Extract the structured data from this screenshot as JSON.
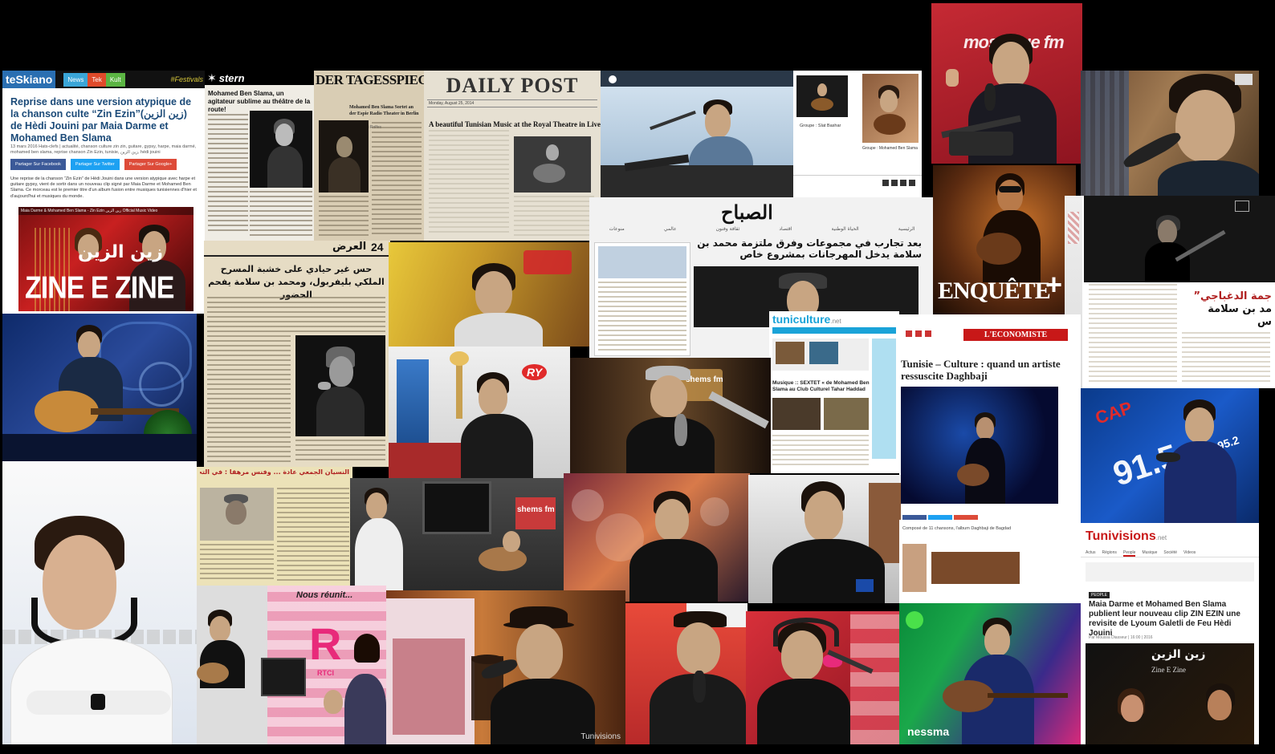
{
  "teskiano": {
    "logo": "teSkiano",
    "nav": [
      "News",
      "Tek",
      "Kult"
    ],
    "festival": "#Festivals",
    "headline": "Reprise dans une version atypique de la chanson culte “Zin Ezin”(زين الزين) de Hèdi Jouini par Maia Darme et Mohamed Ben Slama",
    "meta_date": "13 mars 2016",
    "meta_tags": "Hats-clefs | actualité, chanson culture zin zin, guitare, gypsy, harpe, maia darmé, mohamed ben slama, reprise chanson Zin Ezin, tunisie, زين الزين, hédi jouini",
    "share": [
      "Partager Sur Facebook",
      "Partager Sur Twitter",
      "Partager Sur Google+"
    ],
    "paragraph": "Une reprise de la chanson “Zin Ezin” de Hèdi Jouini dans une version atypique avec harpe et guitare gypsy, vient de sortir dans un nouveau clip signé par Maia Darme et Mohamed Ben Slama. Ce morceau est le premier titre d'un album fusion entre musiques tunisiennes d'hier et d'aujourd'hui et musiques du monde.",
    "video_caption": "Maia Darme & Mohamed Ben Slama - Zin Ezin زين الزين Official Music Video",
    "video_title_ar": "زين الزين",
    "video_title": "ZINE E ZINE"
  },
  "stern": {
    "logo": "stern",
    "headline": "Mohamed Ben Slama, un agitateur sublime au théâtre de la route!"
  },
  "tagesspiegel": {
    "logo": "DER TAGESSPIEGEL",
    "headline": "Mohamed Ben Slama Sortet an der Espie Radio Theater in Berlin",
    "byline": "Von Hamdi Rolfes"
  },
  "daily_post": {
    "masthead": "DAILY POST",
    "date": "Monday, August 25, 2014",
    "headline": "A beautiful Tunisian Music at the Royal Theatre in Liverpool"
  },
  "gallery_caption": {
    "caption1": "Groupe : Slat Bashar",
    "caption2": "Groupe : Mohamed Ben Slama"
  },
  "assabah": {
    "logo": "الصباح",
    "headline": "بعد تجارب في مجموعات وفرق ملتزمة محمد بن سلامة يدخل المهرجانات بمشروع خاص",
    "nav": [
      "الرئيسية",
      "الحياة الوطنية",
      "اقتصاد",
      "ثقافة وفنون",
      "عالمي",
      "منوعات"
    ]
  },
  "arabic_headline_24": {
    "num": "24",
    "word": "العرض",
    "headline": "حس غير حيادي على خشبة المسرح الملكي بليفربول، ومحمد بن سلامة يفحم الحضور"
  },
  "arabic_strip": {
    "text": "النسيان الجمعي عادة ... وفنس مرهقا : في التحلم الغربي"
  },
  "tuniculture": {
    "logo": "tuniculture",
    "tld": ".net",
    "headline": "Musique :: SEXTET « de Mohamed Ben Slama au Club Culturel Tahar Haddad"
  },
  "mosaique": {
    "logo": "mosaique fm"
  },
  "enquete": {
    "logo": "ENQUÊTE",
    "plus": "+"
  },
  "leconomiste": {
    "logo": "L'ECONOMISTE",
    "headline": "Tunisie – Culture : quand un artiste ressuscite Daghbaji",
    "caption": "Composé de 11 chansons, l'album Daghbaji de Bagdad"
  },
  "arabic_right": {
    "title": "جمة الدغباجي”",
    "subtitle": "مد بن سلامة",
    "tail": "س"
  },
  "cap_fm": {
    "logo": "CAP",
    "freq": "91.5",
    "freq2": "95.2"
  },
  "tunivisions": {
    "logo": "Tunivisions",
    "tld": ".net",
    "tabs": [
      "Actus",
      "Régions",
      "People",
      "Musique",
      "Société",
      "Videos"
    ],
    "badge": "PEOPLE",
    "headline": "Maia Darme et Mohamed Ben Slama publient leur nouveau clip ZIN EZIN une revisite de Lyoum Galetli de Feu Hèdi Jouini",
    "byline": "Par Moussa Diasseur | 16:00 | 2016",
    "clip_title_ar": "زين الزين",
    "clip_title": "Zine E Zine"
  },
  "nous_reunit": {
    "text": "Nous réunit...",
    "logo": "RTCI"
  },
  "watermarks": {
    "shems": "shems fm",
    "ry": "RY",
    "tunivisions_wm": "Tunivisions",
    "nessma": "nessma"
  }
}
